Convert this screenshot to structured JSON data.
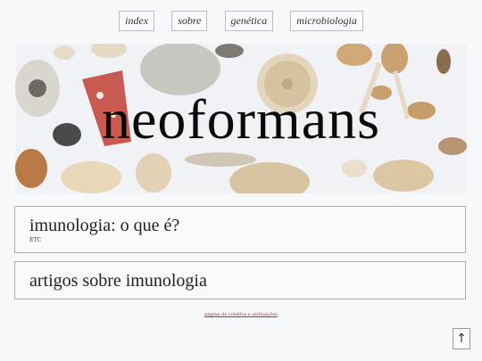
{
  "nav": {
    "items": [
      {
        "label": "index"
      },
      {
        "label": "sobre"
      },
      {
        "label": "genética"
      },
      {
        "label": "microbiologia"
      }
    ]
  },
  "banner": {
    "title": "neoformans"
  },
  "cards": [
    {
      "title": "imunologia: o que é?",
      "subtitle": "ETC"
    },
    {
      "title": "artigos sobre imunologia"
    }
  ],
  "footer": {
    "link": "página de créditos e atribuições"
  },
  "back_to_top": {
    "glyph": "↑",
    "icon": "arrow-up-icon"
  }
}
